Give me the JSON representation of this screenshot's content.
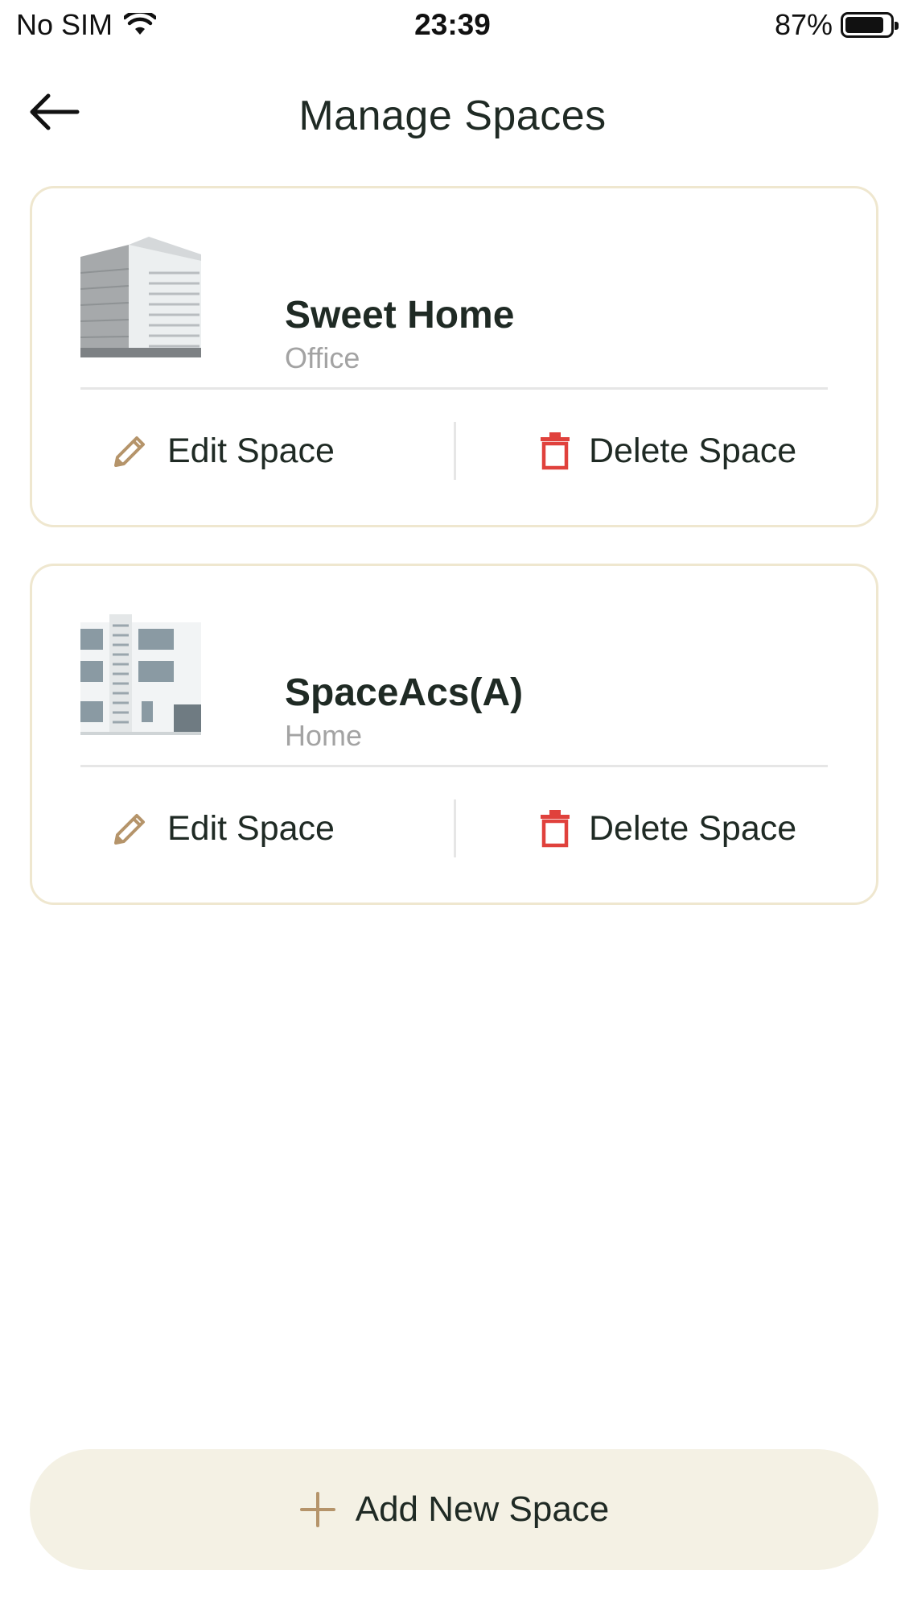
{
  "status_bar": {
    "carrier": "No SIM",
    "time": "23:39",
    "battery_percent_text": "87%",
    "battery_level": 0.87
  },
  "header": {
    "title": "Manage Spaces",
    "back_icon": "arrow-left-icon"
  },
  "spaces": [
    {
      "name": "Sweet Home",
      "type": "Office",
      "thumbnail": "office-tower-image",
      "edit_label": "Edit Space",
      "delete_label": "Delete Space"
    },
    {
      "name": "SpaceAcs(A)",
      "type": "Home",
      "thumbnail": "apartment-building-image",
      "edit_label": "Edit Space",
      "delete_label": "Delete Space"
    }
  ],
  "footer": {
    "add_label": "Add New Space",
    "add_icon": "plus-icon"
  },
  "colors": {
    "accent": "#b5946a",
    "delete": "#e0413c",
    "card_border": "#efe7cf",
    "add_button_bg": "#f4f1e4",
    "text": "#1f2a24",
    "subtext": "#a3a3a3"
  }
}
